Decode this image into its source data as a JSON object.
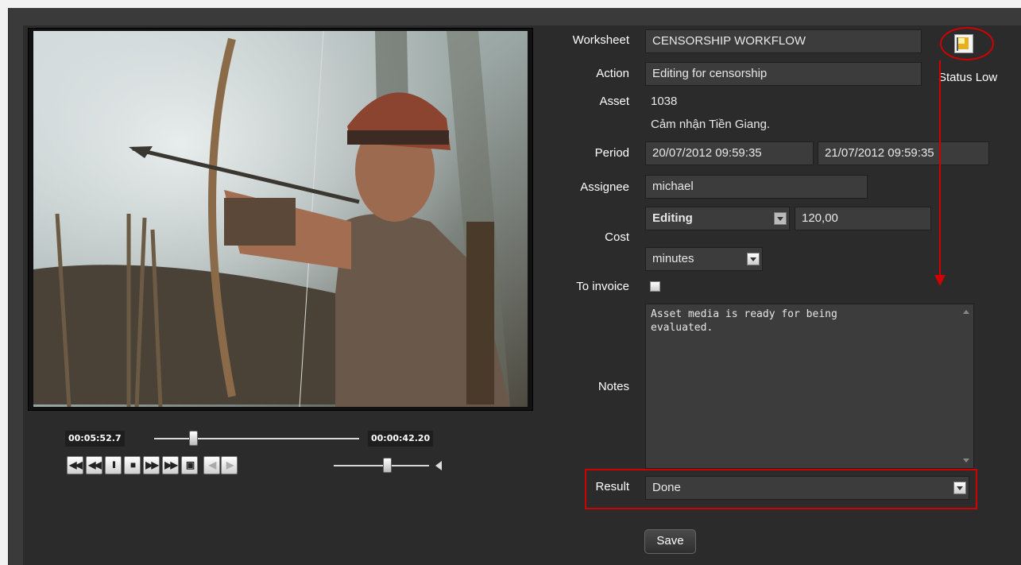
{
  "player": {
    "current_time": "00:05:52.7",
    "duration": "00:00:42.20",
    "progress": 0.17,
    "volume": 0.52,
    "controls": [
      "first-icon",
      "rewind-icon",
      "pause-icon",
      "stop-icon",
      "fast-forward-icon",
      "last-icon",
      "fullscreen-icon",
      "frame-back-icon",
      "frame-forward-icon"
    ]
  },
  "form": {
    "worksheet_label": "Worksheet",
    "worksheet_value": "CENSORSHIP WORKFLOW",
    "action_label": "Action",
    "action_value": "Editing for censorship",
    "asset_label": "Asset",
    "asset_id": "1038",
    "asset_name": "Cảm nhận Tiền Giang.",
    "period_label": "Period",
    "period_start": "20/07/2012 09:59:35",
    "period_end": "21/07/2012 09:59:35",
    "assignee_label": "Assignee",
    "assignee_value": "michael",
    "cost_label": "Cost",
    "cost_type": "Editing",
    "cost_value": "120,00",
    "cost_unit": "minutes",
    "invoice_label": "To invoice",
    "notes_label": "Notes",
    "notes_value": "Asset media is ready for being\nevaluated.",
    "result_label": "Result",
    "result_value": "Done",
    "save_label": "Save"
  },
  "status": {
    "label": "Status Low",
    "icon": "flag-icon"
  },
  "annotation_color": "#d10000"
}
